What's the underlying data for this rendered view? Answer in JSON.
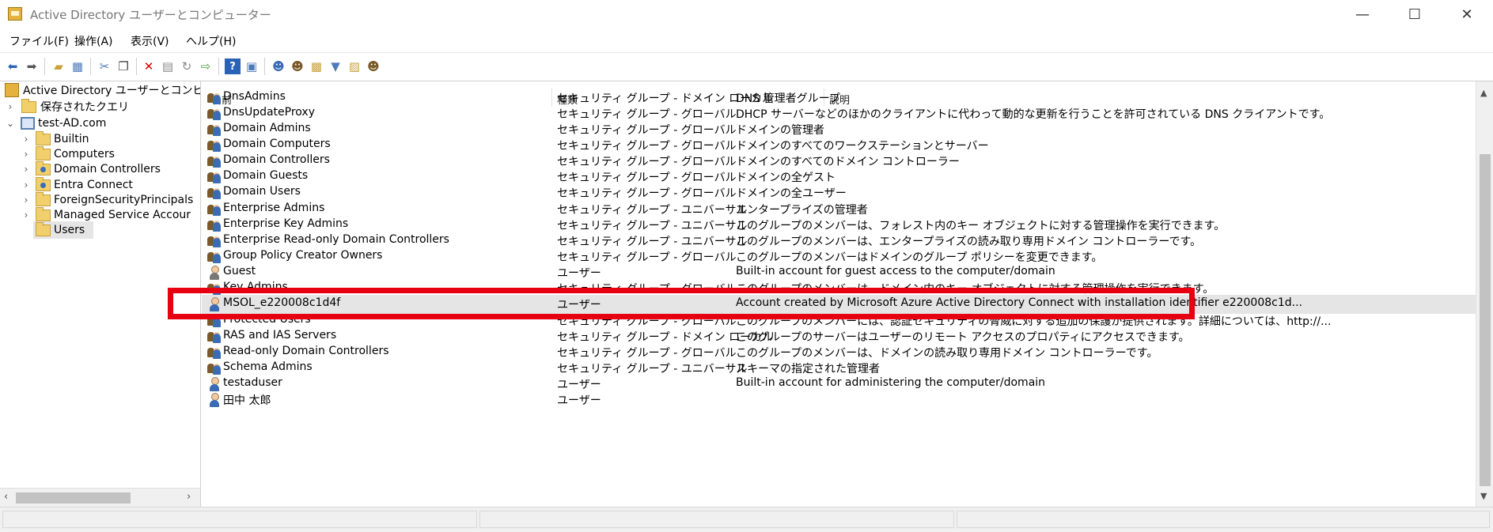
{
  "window": {
    "title": "Active Directory ユーザーとコンピューター",
    "minimize": "—",
    "maximize": "☐",
    "close": "✕"
  },
  "menu": [
    "ファイル(F)",
    "操作(A)",
    "表示(V)",
    "ヘルプ(H)"
  ],
  "toolbar": {
    "icons": [
      "back-arrow-icon",
      "forward-arrow-icon",
      "up-folder-icon",
      "show-console-tree-icon",
      "cut-icon",
      "copy-icon",
      "delete-icon",
      "properties-icon",
      "refresh-icon",
      "export-list-icon",
      "help-icon",
      "show-action-pane-icon",
      "new-user-icon",
      "new-group-icon",
      "new-ou-icon",
      "filter-icon",
      "find-icon",
      "add-to-group-icon"
    ]
  },
  "tree": {
    "root": "Active Directory ユーザーとコンピュー",
    "saved_queries": "保存されたクエリ",
    "domain": "test-AD.com",
    "children": [
      "Builtin",
      "Computers",
      "Domain Controllers",
      "Entra Connect",
      "ForeignSecurityPrincipals",
      "Managed Service Accour",
      "Users"
    ]
  },
  "list": {
    "columns": [
      "名前",
      "種類",
      "説明"
    ],
    "rows": [
      {
        "name": "DnsAdmins",
        "type": "セキュリティ グループ - ドメイン ローカル",
        "desc": "DNS 管理者グループ",
        "icon": "group"
      },
      {
        "name": "DnsUpdateProxy",
        "type": "セキュリティ グループ - グローバル",
        "desc": "DHCP サーバーなどのほかのクライアントに代わって動的な更新を行うことを許可されている DNS クライアントです。",
        "icon": "group"
      },
      {
        "name": "Domain Admins",
        "type": "セキュリティ グループ - グローバル",
        "desc": "ドメインの管理者",
        "icon": "group"
      },
      {
        "name": "Domain Computers",
        "type": "セキュリティ グループ - グローバル",
        "desc": "ドメインのすべてのワークステーションとサーバー",
        "icon": "group"
      },
      {
        "name": "Domain Controllers",
        "type": "セキュリティ グループ - グローバル",
        "desc": "ドメインのすべてのドメイン コントローラー",
        "icon": "group"
      },
      {
        "name": "Domain Guests",
        "type": "セキュリティ グループ - グローバル",
        "desc": "ドメインの全ゲスト",
        "icon": "group"
      },
      {
        "name": "Domain Users",
        "type": "セキュリティ グループ - グローバル",
        "desc": "ドメインの全ユーザー",
        "icon": "group"
      },
      {
        "name": "Enterprise Admins",
        "type": "セキュリティ グループ - ユニバーサル",
        "desc": "エンタープライズの管理者",
        "icon": "group"
      },
      {
        "name": "Enterprise Key Admins",
        "type": "セキュリティ グループ - ユニバーサル",
        "desc": "このグループのメンバーは、フォレスト内のキー オブジェクトに対する管理操作を実行できます。",
        "icon": "group"
      },
      {
        "name": "Enterprise Read-only Domain Controllers",
        "type": "セキュリティ グループ - ユニバーサル",
        "desc": "このグループのメンバーは、エンタープライズの読み取り専用ドメイン コントローラーです。",
        "icon": "group"
      },
      {
        "name": "Group Policy Creator Owners",
        "type": "セキュリティ グループ - グローバル",
        "desc": "このグループのメンバーはドメインのグループ ポリシーを変更できます。",
        "icon": "group"
      },
      {
        "name": "Guest",
        "type": "ユーザー",
        "desc": "Built-in account for guest access to the computer/domain",
        "icon": "guest"
      },
      {
        "name": "Key Admins",
        "type": "セキュリティ グループ - グローバル",
        "desc": "このグループのメンバーは、ドメイン内のキー オブジェクトに対する管理操作を実行できます。",
        "icon": "group"
      },
      {
        "name": "MSOL_e220008c1d4f",
        "type": "ユーザー",
        "desc": "Account created by Microsoft Azure Active Directory Connect with installation identifier e220008c1d...",
        "icon": "user",
        "selected": true
      },
      {
        "name": "Protected Users",
        "type": "セキュリティ グループ - グローバル",
        "desc": "このグループのメンバーには、認証セキュリティの脅威に対する追加の保護が提供されます。詳細については、http://...",
        "icon": "group"
      },
      {
        "name": "RAS and IAS Servers",
        "type": "セキュリティ グループ - ドメイン ローカル",
        "desc": "このグループのサーバーはユーザーのリモート アクセスのプロパティにアクセスできます。",
        "icon": "group"
      },
      {
        "name": "Read-only Domain Controllers",
        "type": "セキュリティ グループ - グローバル",
        "desc": "このグループのメンバーは、ドメインの読み取り専用ドメイン コントローラーです。",
        "icon": "group"
      },
      {
        "name": "Schema Admins",
        "type": "セキュリティ グループ - ユニバーサル",
        "desc": "スキーマの指定された管理者",
        "icon": "group"
      },
      {
        "name": "testaduser",
        "type": "ユーザー",
        "desc": "Built-in account for administering the computer/domain",
        "icon": "user"
      },
      {
        "name": "田中 太郎",
        "type": "ユーザー",
        "desc": "",
        "icon": "user"
      }
    ]
  },
  "highlight_color": "#e60012"
}
